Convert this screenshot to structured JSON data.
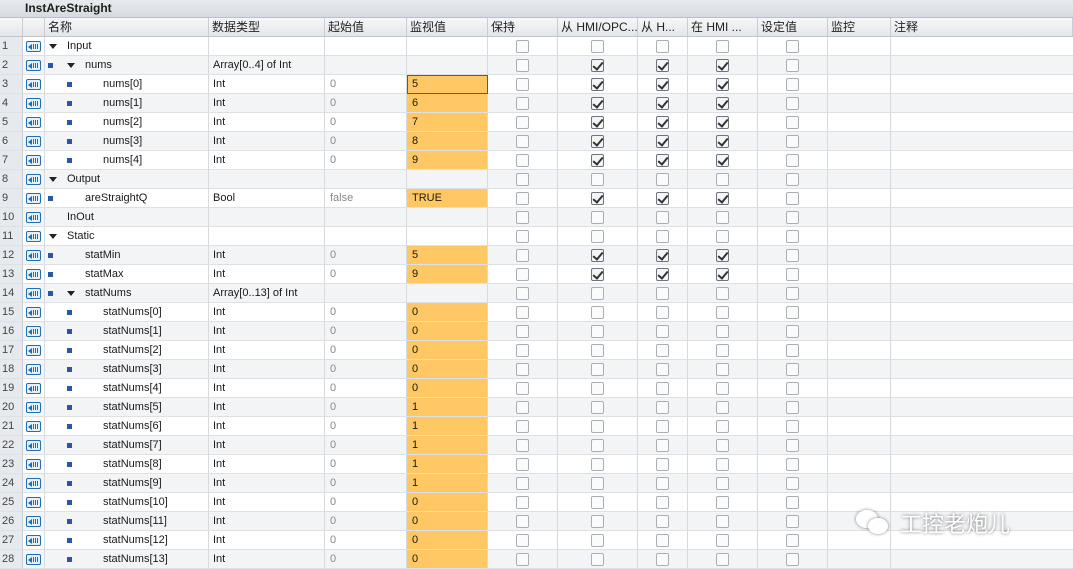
{
  "window": {
    "title": "InstAreStraight"
  },
  "columns": {
    "name": "名称",
    "datatype": "数据类型",
    "start_value": "起始值",
    "monitor_value": "监视值",
    "retain": "保持",
    "hmi_opc": "从 HMI/OPC...",
    "hmi_h": "从 H...",
    "in_hmi": "在 HMI ...",
    "setpoint": "设定值",
    "watch": "监控",
    "comment": "注释"
  },
  "rows": [
    {
      "n": "1",
      "name": "Input",
      "type": "",
      "start": "",
      "mon": "",
      "level": 0,
      "expand": true,
      "bullet": false,
      "retain": false,
      "c1": false,
      "c2": false,
      "c3": false,
      "set": false
    },
    {
      "n": "2",
      "name": "nums",
      "type": "Array[0..4] of Int",
      "start": "",
      "mon": "",
      "level": 1,
      "expand": true,
      "bullet": true,
      "retain": false,
      "c1": true,
      "c2": true,
      "c3": true,
      "set": false
    },
    {
      "n": "3",
      "name": "nums[0]",
      "type": "Int",
      "start": "0",
      "mon": "5",
      "level": 2,
      "bullet": true,
      "retain": false,
      "c1": true,
      "c2": true,
      "c3": true,
      "set": false,
      "selected": true
    },
    {
      "n": "4",
      "name": "nums[1]",
      "type": "Int",
      "start": "0",
      "mon": "6",
      "level": 2,
      "bullet": true,
      "retain": false,
      "c1": true,
      "c2": true,
      "c3": true,
      "set": false
    },
    {
      "n": "5",
      "name": "nums[2]",
      "type": "Int",
      "start": "0",
      "mon": "7",
      "level": 2,
      "bullet": true,
      "retain": false,
      "c1": true,
      "c2": true,
      "c3": true,
      "set": false
    },
    {
      "n": "6",
      "name": "nums[3]",
      "type": "Int",
      "start": "0",
      "mon": "8",
      "level": 2,
      "bullet": true,
      "retain": false,
      "c1": true,
      "c2": true,
      "c3": true,
      "set": false
    },
    {
      "n": "7",
      "name": "nums[4]",
      "type": "Int",
      "start": "0",
      "mon": "9",
      "level": 2,
      "bullet": true,
      "retain": false,
      "c1": true,
      "c2": true,
      "c3": true,
      "set": false
    },
    {
      "n": "8",
      "name": "Output",
      "type": "",
      "start": "",
      "mon": "",
      "level": 0,
      "expand": true,
      "bullet": false,
      "retain": false,
      "c1": false,
      "c2": false,
      "c3": false,
      "set": false
    },
    {
      "n": "9",
      "name": "areStraightQ",
      "type": "Bool",
      "start": "false",
      "mon": "TRUE",
      "level": 1,
      "bullet": true,
      "retain": false,
      "c1": true,
      "c2": true,
      "c3": true,
      "set": false
    },
    {
      "n": "10",
      "name": "InOut",
      "type": "",
      "start": "",
      "mon": "",
      "level": 0,
      "bullet": false,
      "retain": false,
      "c1": false,
      "c2": false,
      "c3": false,
      "set": false
    },
    {
      "n": "11",
      "name": "Static",
      "type": "",
      "start": "",
      "mon": "",
      "level": 0,
      "expand": true,
      "bullet": false,
      "retain": false,
      "c1": false,
      "c2": false,
      "c3": false,
      "set": false
    },
    {
      "n": "12",
      "name": "statMin",
      "type": "Int",
      "start": "0",
      "mon": "5",
      "level": 1,
      "bullet": true,
      "retain": false,
      "c1": true,
      "c2": true,
      "c3": true,
      "set": false
    },
    {
      "n": "13",
      "name": "statMax",
      "type": "Int",
      "start": "0",
      "mon": "9",
      "level": 1,
      "bullet": true,
      "retain": false,
      "c1": true,
      "c2": true,
      "c3": true,
      "set": false
    },
    {
      "n": "14",
      "name": "statNums",
      "type": "Array[0..13] of Int",
      "start": "",
      "mon": "",
      "level": 1,
      "expand": true,
      "bullet": true,
      "retain": false,
      "c1": false,
      "c2": false,
      "c3": false,
      "set": false
    },
    {
      "n": "15",
      "name": "statNums[0]",
      "type": "Int",
      "start": "0",
      "mon": "0",
      "level": 2,
      "bullet": true,
      "retain": false,
      "c1": false,
      "c2": false,
      "c3": false,
      "set": false
    },
    {
      "n": "16",
      "name": "statNums[1]",
      "type": "Int",
      "start": "0",
      "mon": "0",
      "level": 2,
      "bullet": true,
      "retain": false,
      "c1": false,
      "c2": false,
      "c3": false,
      "set": false
    },
    {
      "n": "17",
      "name": "statNums[2]",
      "type": "Int",
      "start": "0",
      "mon": "0",
      "level": 2,
      "bullet": true,
      "retain": false,
      "c1": false,
      "c2": false,
      "c3": false,
      "set": false
    },
    {
      "n": "18",
      "name": "statNums[3]",
      "type": "Int",
      "start": "0",
      "mon": "0",
      "level": 2,
      "bullet": true,
      "retain": false,
      "c1": false,
      "c2": false,
      "c3": false,
      "set": false
    },
    {
      "n": "19",
      "name": "statNums[4]",
      "type": "Int",
      "start": "0",
      "mon": "0",
      "level": 2,
      "bullet": true,
      "retain": false,
      "c1": false,
      "c2": false,
      "c3": false,
      "set": false
    },
    {
      "n": "20",
      "name": "statNums[5]",
      "type": "Int",
      "start": "0",
      "mon": "1",
      "level": 2,
      "bullet": true,
      "retain": false,
      "c1": false,
      "c2": false,
      "c3": false,
      "set": false
    },
    {
      "n": "21",
      "name": "statNums[6]",
      "type": "Int",
      "start": "0",
      "mon": "1",
      "level": 2,
      "bullet": true,
      "retain": false,
      "c1": false,
      "c2": false,
      "c3": false,
      "set": false
    },
    {
      "n": "22",
      "name": "statNums[7]",
      "type": "Int",
      "start": "0",
      "mon": "1",
      "level": 2,
      "bullet": true,
      "retain": false,
      "c1": false,
      "c2": false,
      "c3": false,
      "set": false
    },
    {
      "n": "23",
      "name": "statNums[8]",
      "type": "Int",
      "start": "0",
      "mon": "1",
      "level": 2,
      "bullet": true,
      "retain": false,
      "c1": false,
      "c2": false,
      "c3": false,
      "set": false
    },
    {
      "n": "24",
      "name": "statNums[9]",
      "type": "Int",
      "start": "0",
      "mon": "1",
      "level": 2,
      "bullet": true,
      "retain": false,
      "c1": false,
      "c2": false,
      "c3": false,
      "set": false
    },
    {
      "n": "25",
      "name": "statNums[10]",
      "type": "Int",
      "start": "0",
      "mon": "0",
      "level": 2,
      "bullet": true,
      "retain": false,
      "c1": false,
      "c2": false,
      "c3": false,
      "set": false
    },
    {
      "n": "26",
      "name": "statNums[11]",
      "type": "Int",
      "start": "0",
      "mon": "0",
      "level": 2,
      "bullet": true,
      "retain": false,
      "c1": false,
      "c2": false,
      "c3": false,
      "set": false
    },
    {
      "n": "27",
      "name": "statNums[12]",
      "type": "Int",
      "start": "0",
      "mon": "0",
      "level": 2,
      "bullet": true,
      "retain": false,
      "c1": false,
      "c2": false,
      "c3": false,
      "set": false
    },
    {
      "n": "28",
      "name": "statNums[13]",
      "type": "Int",
      "start": "0",
      "mon": "0",
      "level": 2,
      "bullet": true,
      "retain": false,
      "c1": false,
      "c2": false,
      "c3": false,
      "set": false
    }
  ],
  "watermark": {
    "text": "工控老炮儿",
    "icon": "wechat-icon"
  },
  "colors": {
    "monitor_fill": "#ffc864",
    "bullet": "#2a55a8",
    "icon_blue": "#1e6fb5"
  }
}
